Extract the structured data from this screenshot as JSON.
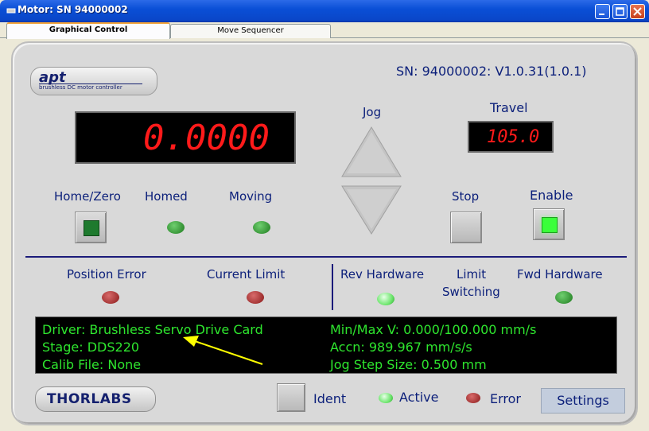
{
  "window": {
    "title": "Motor: SN 94000002"
  },
  "tabs": [
    {
      "label": "Graphical Control"
    },
    {
      "label": "Move Sequencer"
    }
  ],
  "header": {
    "logo_word": "apt",
    "logo_sub": "brushless DC motor controller",
    "serial": "SN: 94000002: V1.0.31(1.0.1)"
  },
  "position_display": "0.0000",
  "jog": {
    "label": "Jog"
  },
  "travel": {
    "label": "Travel",
    "value": "105.0"
  },
  "controls": {
    "home_zero": "Home/Zero",
    "homed": "Homed",
    "moving": "Moving",
    "stop": "Stop",
    "enable": "Enable"
  },
  "status": {
    "position_error": "Position Error",
    "current_limit": "Current Limit",
    "rev_hardware": "Rev Hardware",
    "limit_switching": [
      "Limit",
      "Switching"
    ],
    "fwd_hardware": "Fwd Hardware"
  },
  "info": {
    "driver": "Driver: Brushless Servo Drive Card",
    "stage": "Stage: DDS220",
    "calib": "Calib File: None",
    "minmax": "Min/Max V: 0.000/100.000 mm/s",
    "accn": "Accn: 989.967 mm/s/s",
    "jogstep": "Jog Step Size: 0.500 mm"
  },
  "footer": {
    "brand": "THORLABS",
    "ident": "Ident",
    "active": "Active",
    "error": "Error",
    "settings": "Settings"
  },
  "colors": {
    "label_blue": "#0b1f7a",
    "led_green": "#2aa02a",
    "led_red": "#8a1a1a",
    "display_red": "#ff1a1a",
    "info_green": "#2ee62e",
    "annotation_arrow": "#ffff00"
  }
}
